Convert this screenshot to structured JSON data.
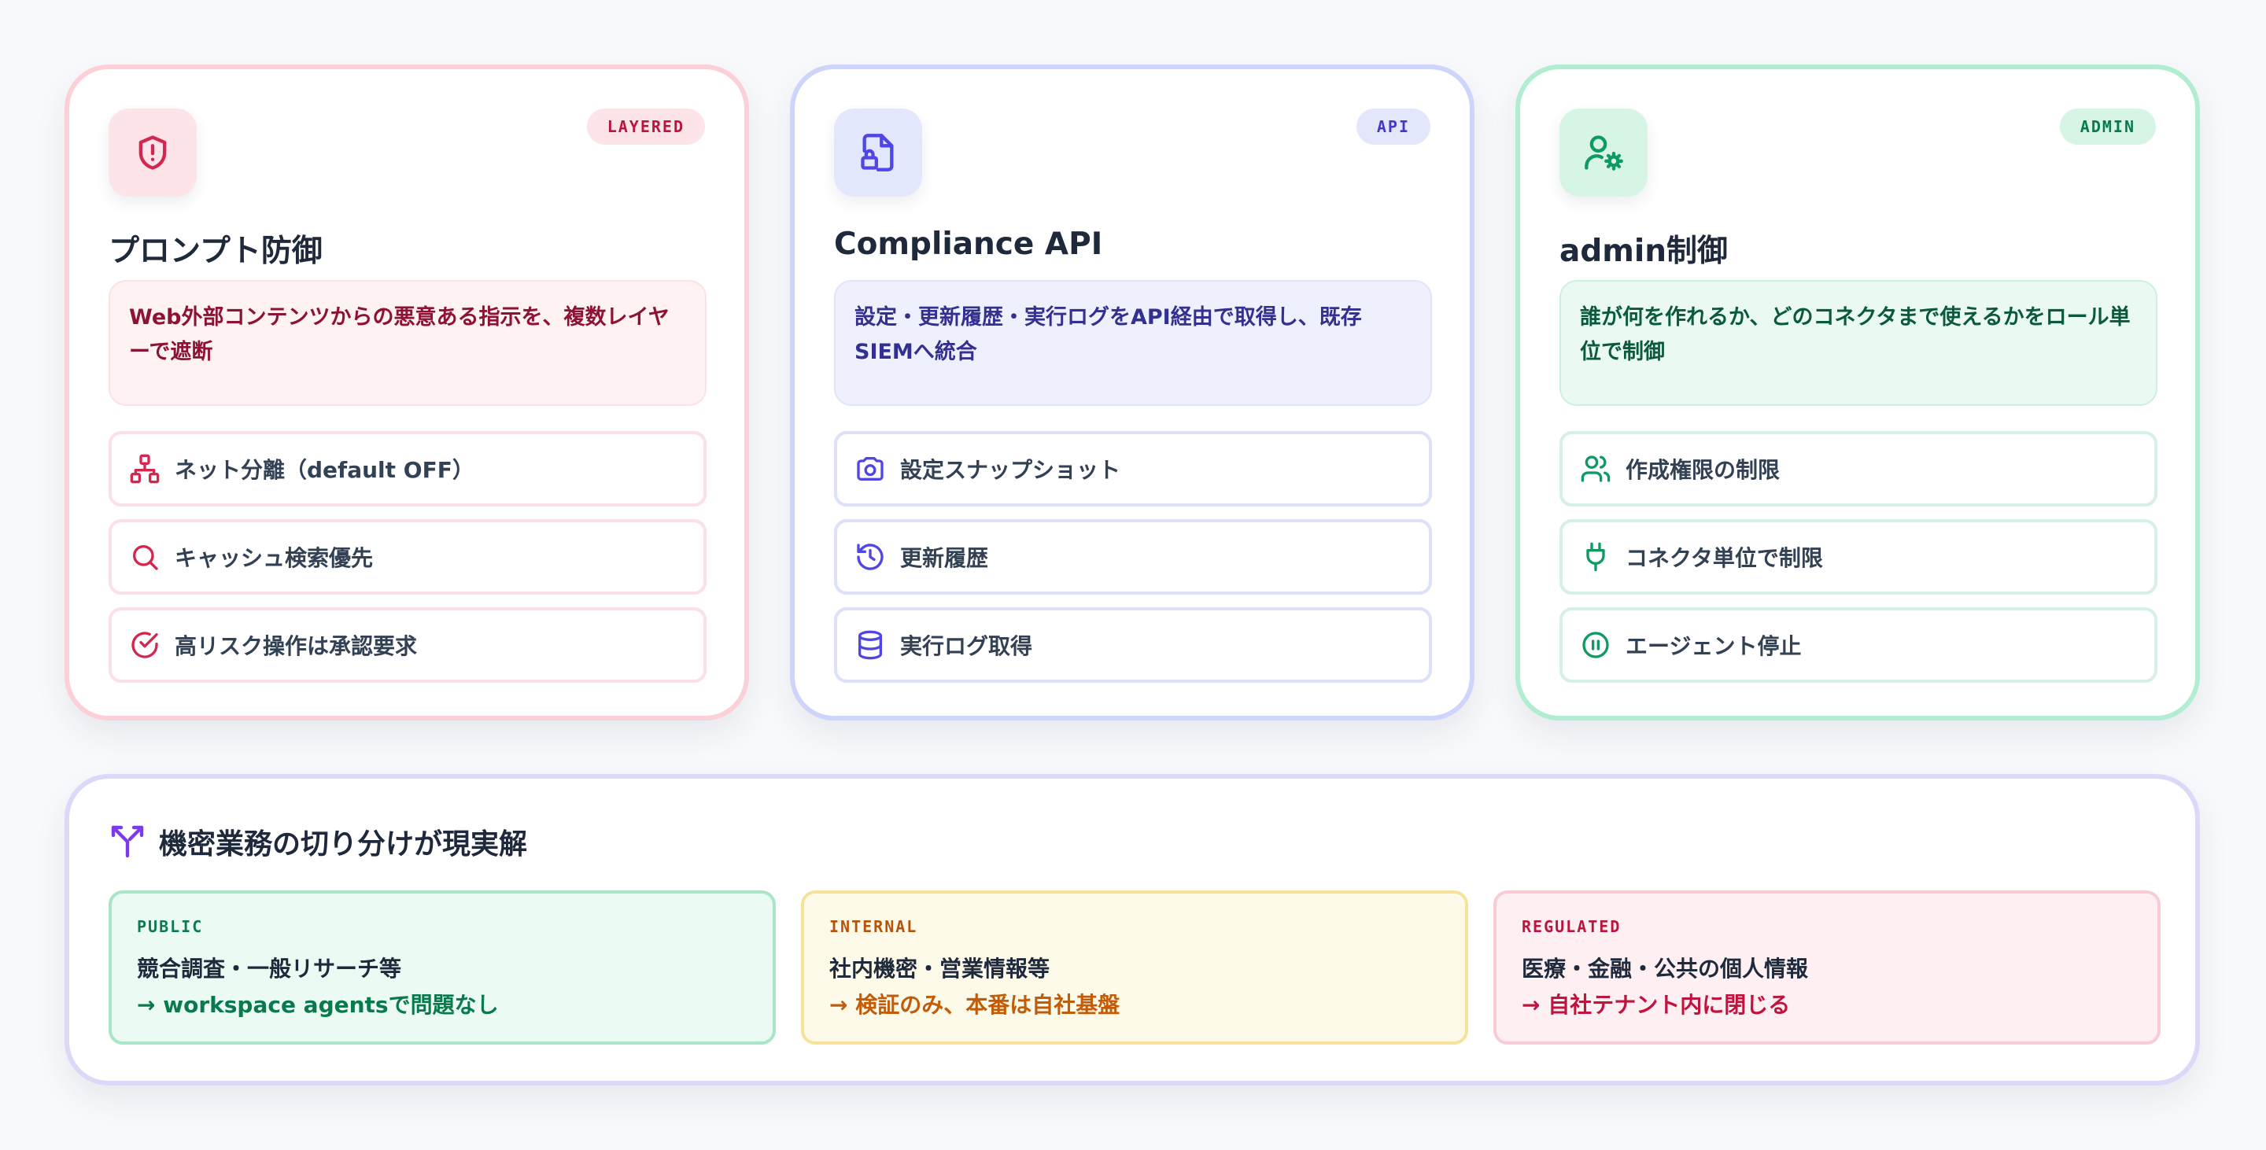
{
  "cards": [
    {
      "badge": "LAYERED",
      "icon": "shield-alert-icon",
      "title": "プロンプト防御",
      "description": "Web外部コンテンツからの悪意ある指示を、複数レイヤーで遮断",
      "items": [
        {
          "icon": "network-icon",
          "label": "ネット分離（default OFF）"
        },
        {
          "icon": "search-icon",
          "label": "キャッシュ検索優先"
        },
        {
          "icon": "check-circle-icon",
          "label": "高リスク操作は承認要求"
        }
      ],
      "accent": "#d2284f"
    },
    {
      "badge": "API",
      "icon": "file-lock-icon",
      "title": "Compliance API",
      "description": "設定・更新履歴・実行ログをAPI経由で取得し、既存SIEMへ統合",
      "items": [
        {
          "icon": "camera-icon",
          "label": "設定スナップショット"
        },
        {
          "icon": "history-icon",
          "label": "更新履歴"
        },
        {
          "icon": "database-icon",
          "label": "実行ログ取得"
        }
      ],
      "accent": "#4f46e5"
    },
    {
      "badge": "ADMIN",
      "icon": "user-cog-icon",
      "title": "admin制御",
      "description": "誰が何を作れるか、どのコネクタまで使えるかをロール単位で制御",
      "items": [
        {
          "icon": "users-icon",
          "label": "作成権限の制限"
        },
        {
          "icon": "plug-icon",
          "label": "コネクタ単位で制限"
        },
        {
          "icon": "pause-circle-icon",
          "label": "エージェント停止"
        }
      ],
      "accent": "#0f9a62"
    }
  ],
  "segmentation": {
    "icon": "split-icon",
    "title": "機密業務の切り分けが現実解",
    "segments": [
      {
        "label": "PUBLIC",
        "line1": "競合調査・一般リサーチ等",
        "line2": "→ workspace agentsで問題なし"
      },
      {
        "label": "INTERNAL",
        "line1": "社内機密・営業情報等",
        "line2": "→ 検証のみ、本番は自社基盤"
      },
      {
        "label": "REGULATED",
        "line1": "医療・金融・公共の個人情報",
        "line2": "→ 自社テナント内に閉じる"
      }
    ]
  }
}
